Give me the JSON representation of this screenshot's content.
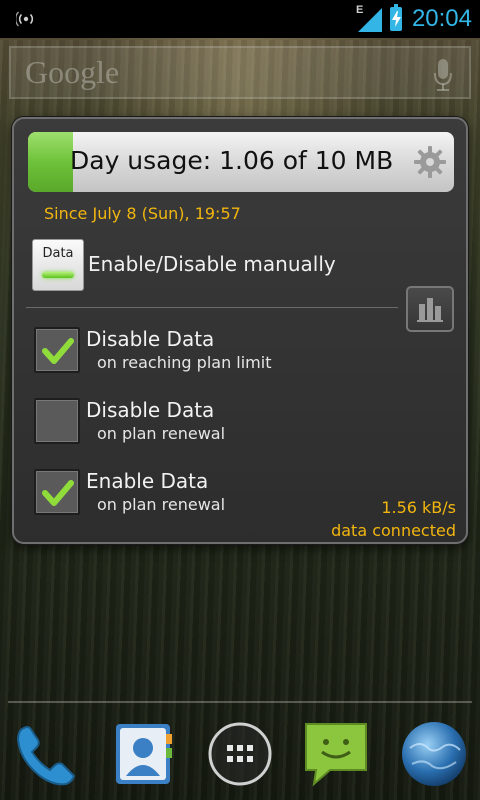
{
  "statusbar": {
    "time": "20:04",
    "network_type": "E",
    "icons": [
      "wifi-icon",
      "signal-icon",
      "battery-charging-icon"
    ]
  },
  "search": {
    "logo_text": "Google",
    "icon": "mic-icon"
  },
  "widget": {
    "usage": {
      "text": "Day usage: 1.06 of 10 MB",
      "used_mb": 1.06,
      "limit_mb": 10,
      "fill_fraction": 0.106,
      "fill_color": "#6ec23a"
    },
    "since_text": "Since July 8 (Sun), 19:57",
    "toggle": {
      "button_label": "Data",
      "label": "Enable/Disable manually",
      "state": "on"
    },
    "options": [
      {
        "title": "Disable Data",
        "subtitle": "on reaching plan limit",
        "checked": true
      },
      {
        "title": "Disable Data",
        "subtitle": "on plan renewal",
        "checked": false
      },
      {
        "title": "Enable Data",
        "subtitle": "on plan renewal",
        "checked": true
      }
    ],
    "rate": {
      "speed": "1.56 kB/s",
      "status": "data connected"
    },
    "accent_color": "#f2b60f"
  },
  "dock": {
    "items": [
      "phone-icon",
      "contacts-icon",
      "app-drawer-icon",
      "messaging-icon",
      "browser-icon"
    ]
  }
}
